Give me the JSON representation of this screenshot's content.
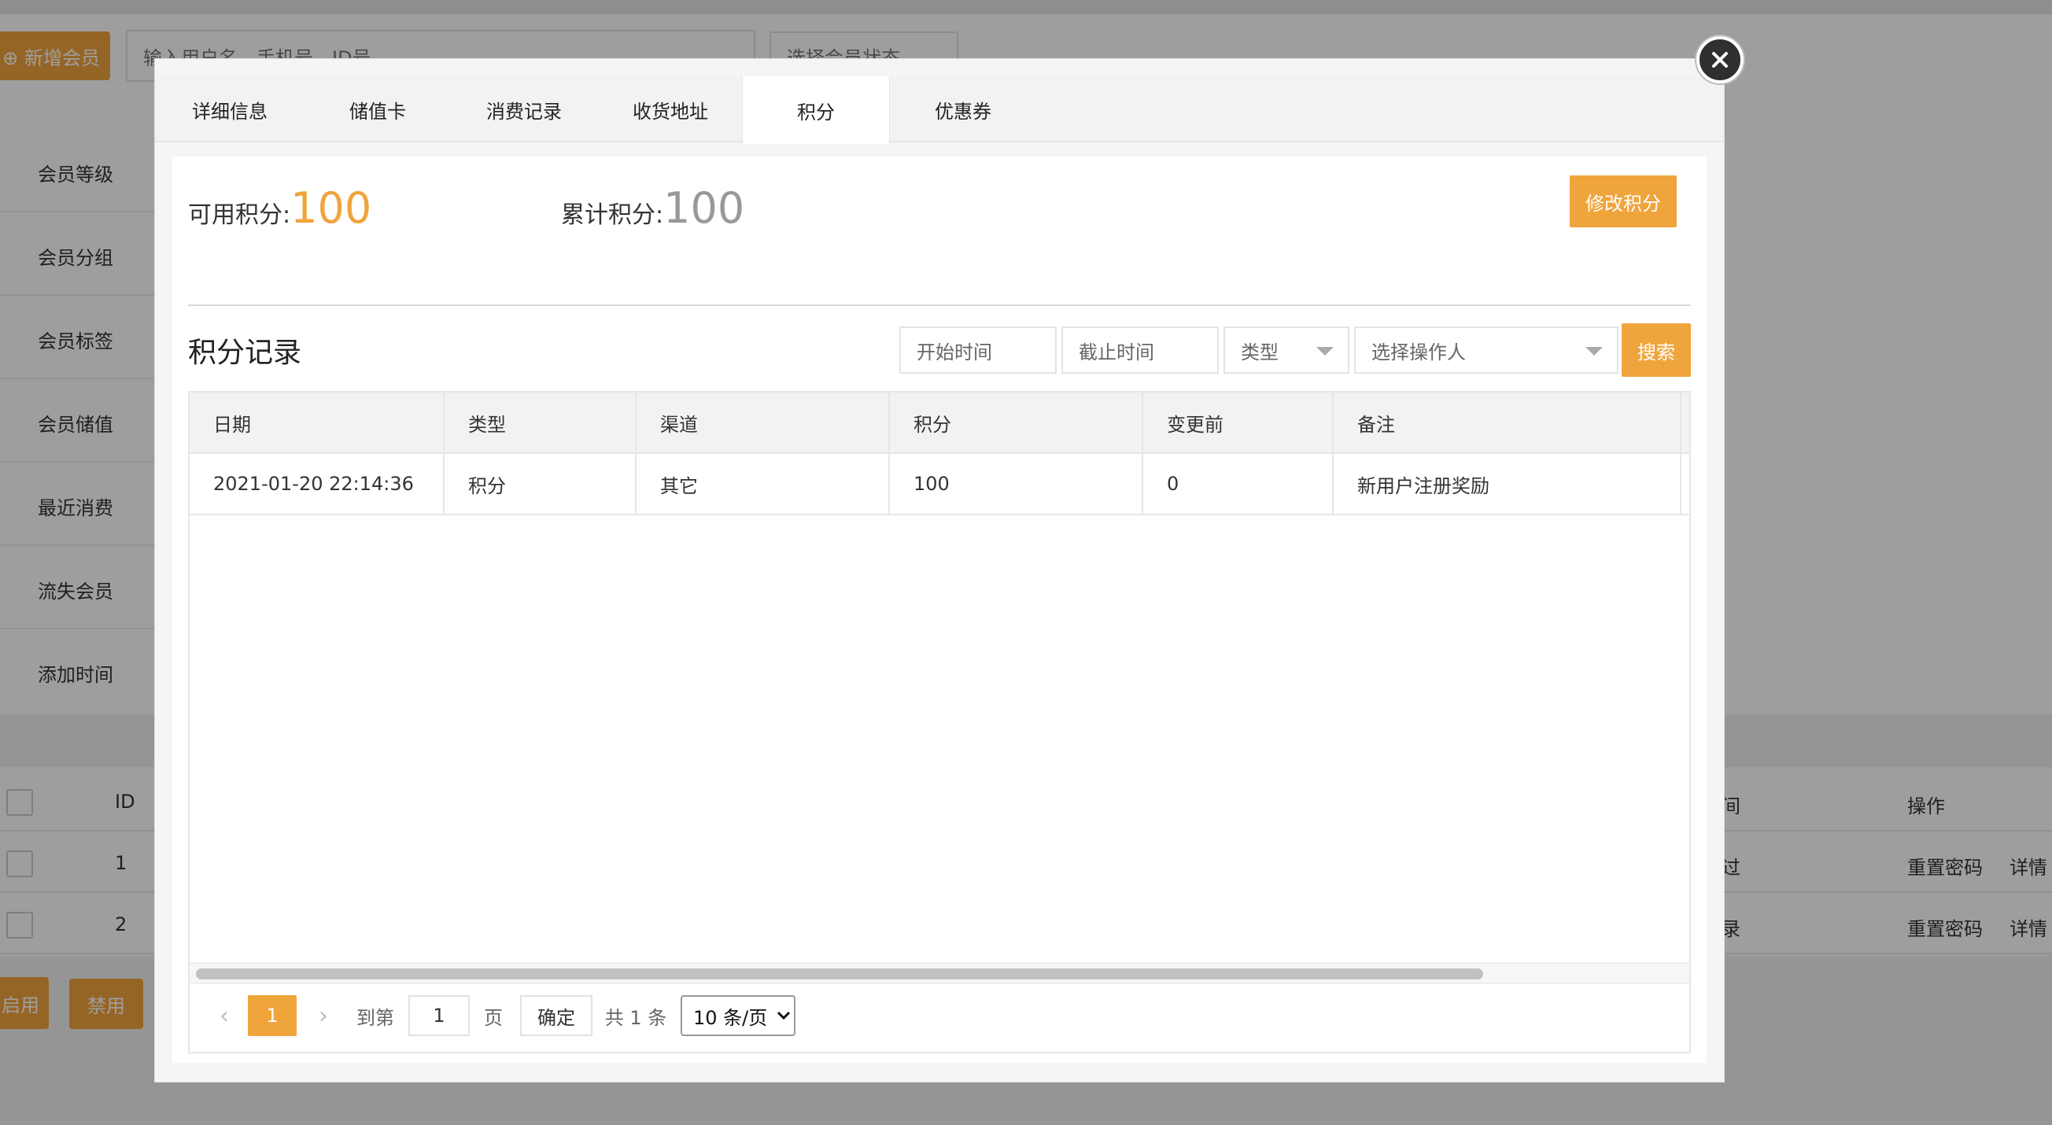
{
  "background": {
    "toolbar": {
      "add_member_label": "⊕ 新增会员",
      "search_placeholder": "输入用户名、手机号、ID号",
      "status_select_label": "选择会员状态"
    },
    "filters": [
      "会员等级",
      "会员分组",
      "会员标签",
      "会员储值",
      "最近消费",
      "流失会员",
      "添加时间"
    ],
    "table": {
      "id_header": "ID",
      "time_header_partial": "间",
      "action_header": "操作",
      "rows": [
        {
          "id": "1",
          "partial": "过",
          "reset": "重置密码",
          "detail": "详情"
        },
        {
          "id": "2",
          "partial": "录",
          "reset": "重置密码",
          "detail": "详情"
        }
      ]
    },
    "enable_label": "启用",
    "disable_label": "禁用"
  },
  "modal": {
    "tabs": [
      "详细信息",
      "储值卡",
      "消费记录",
      "收货地址",
      "积分",
      "优惠券"
    ],
    "active_tab": "积分",
    "available_points_label": "可用积分:",
    "available_points": "100",
    "total_points_label": "累计积分:",
    "total_points": "100",
    "modify_points_label": "修改积分",
    "records_title": "积分记录",
    "filters": {
      "start_placeholder": "开始时间",
      "end_placeholder": "截止时间",
      "type_label": "类型",
      "operator_label": "选择操作人",
      "search_label": "搜索"
    },
    "table": {
      "headers": [
        "日期",
        "类型",
        "渠道",
        "积分",
        "变更前",
        "备注"
      ],
      "rows": [
        [
          "2021-01-20 22:14:36",
          "积分",
          "其它",
          "100",
          "0",
          "新用户注册奖励"
        ]
      ]
    },
    "pagination": {
      "current_page": "1",
      "goto_label": "到第",
      "goto_value": "1",
      "page_unit": "页",
      "confirm_label": "确定",
      "total_label": "共 1 条",
      "page_size_label": "10 条/页"
    }
  },
  "colors": {
    "accent": "#f0a43c",
    "overlay": "rgba(0,0,0,0.38)"
  }
}
